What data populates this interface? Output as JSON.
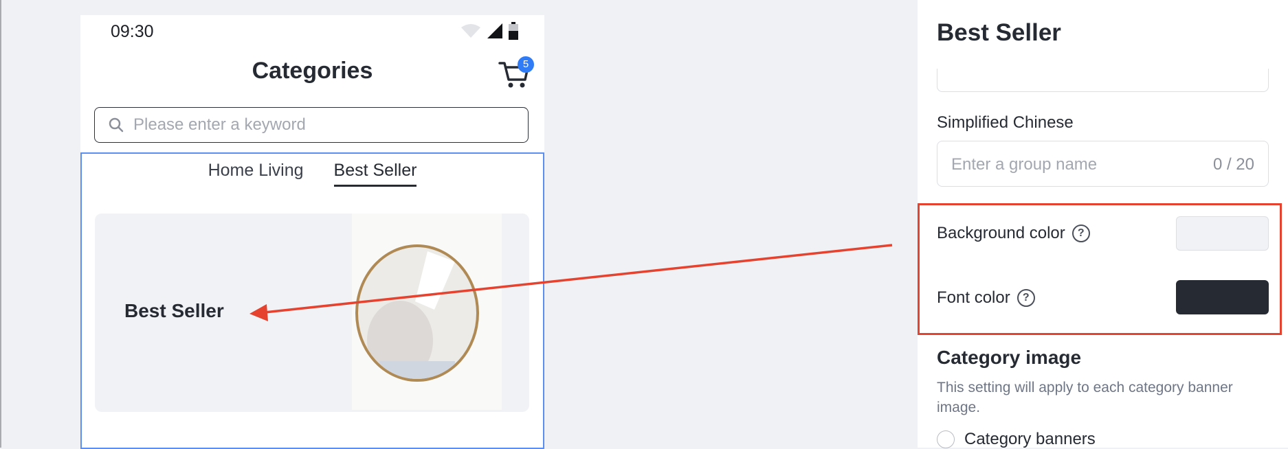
{
  "phone": {
    "status_time": "09:30",
    "title": "Categories",
    "cart_badge": "5",
    "search_placeholder": "Please enter a keyword",
    "tabs": [
      {
        "label": "Home Living",
        "active": false
      },
      {
        "label": "Best Seller",
        "active": true
      }
    ],
    "banner": {
      "title": "Best Seller"
    }
  },
  "panel": {
    "title": "Best Seller",
    "simplified_chinese_label": "Simplified Chinese",
    "group_name_placeholder": "Enter a group name",
    "group_name_counter": "0 / 20",
    "background_color_label": "Background color",
    "font_color_label": "Font color",
    "help_glyph": "?",
    "background_color": "#f1f2f5",
    "font_color": "#262a33",
    "category_image_title": "Category image",
    "category_image_desc": "This setting will apply to each category banner image.",
    "category_banners_label": "Category banners"
  },
  "colors": {
    "accent_blue": "#2f7cf6",
    "selection_blue": "#5b8ef0",
    "annotation_red": "#e5432f"
  },
  "icons": [
    "wifi-icon",
    "signal-icon",
    "battery-icon",
    "cart-icon",
    "search-icon",
    "help-icon",
    "radio-icon"
  ]
}
